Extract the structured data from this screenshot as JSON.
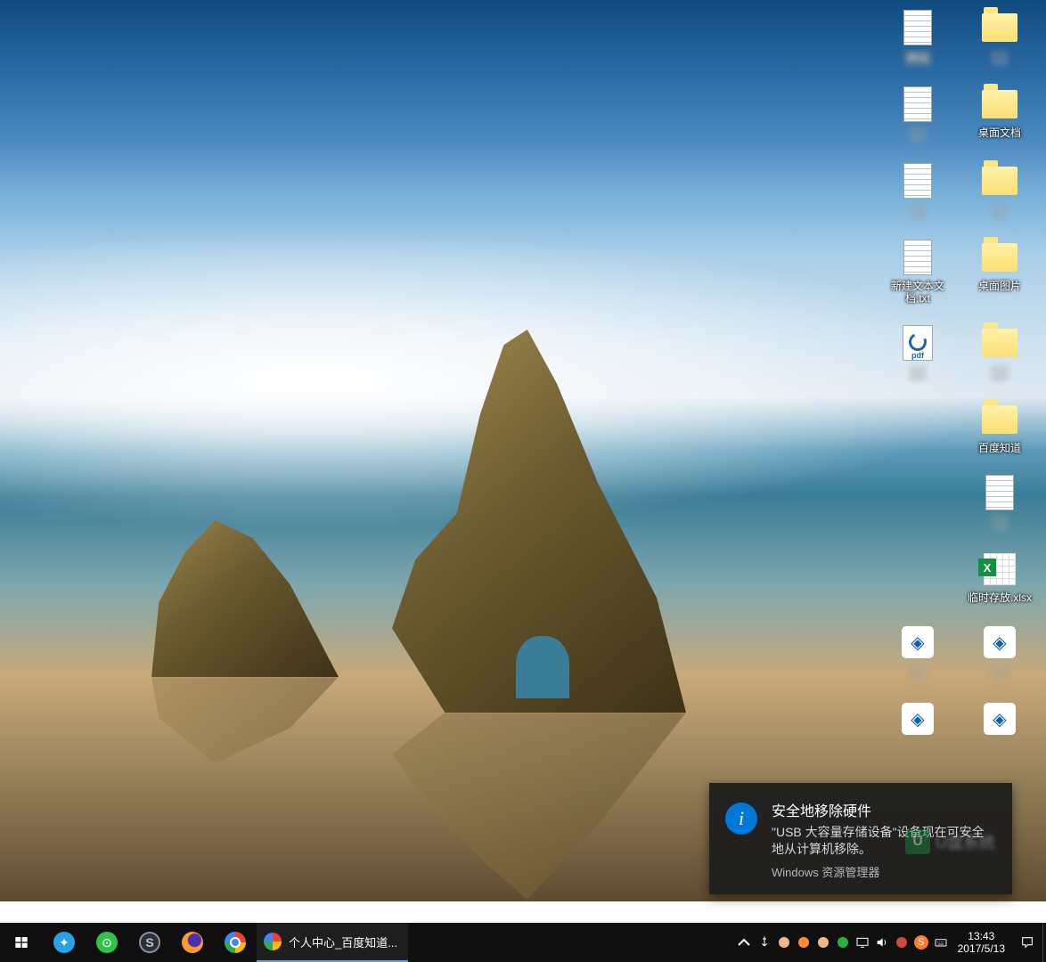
{
  "desktop_icons": [
    {
      "kind": "txt",
      "label": "网站",
      "blur": true
    },
    {
      "kind": "folder",
      "label": "…",
      "blur": true
    },
    {
      "kind": "txt",
      "label": "…",
      "blur": true
    },
    {
      "kind": "folder",
      "label": "桌面文档",
      "blur": false
    },
    {
      "kind": "txt",
      "label": "…",
      "blur": true
    },
    {
      "kind": "folder",
      "label": "…",
      "blur": true
    },
    {
      "kind": "txt",
      "label": "新建文本文档.txt",
      "blur": false
    },
    {
      "kind": "folder",
      "label": "桌面图片",
      "blur": false
    },
    {
      "kind": "pdf",
      "label": "…",
      "blur": true
    },
    {
      "kind": "folder",
      "label": "…",
      "blur": true
    },
    {
      "kind": "none",
      "label": "",
      "blur": false
    },
    {
      "kind": "folder",
      "label": "百度知道",
      "blur": false
    },
    {
      "kind": "none",
      "label": "",
      "blur": false
    },
    {
      "kind": "txt",
      "label": "…",
      "blur": true
    },
    {
      "kind": "none",
      "label": "",
      "blur": false
    },
    {
      "kind": "xlsx",
      "label": "临时存放.xlsx",
      "blur": false
    },
    {
      "kind": "app",
      "label": "…",
      "blur": true
    },
    {
      "kind": "app",
      "label": "…",
      "blur": true
    },
    {
      "kind": "app",
      "label": "",
      "blur": false
    },
    {
      "kind": "app",
      "label": "",
      "blur": false
    }
  ],
  "toast": {
    "title": "安全地移除硬件",
    "message": "\"USB 大容量存储设备\"设备现在可安全地从计算机移除。",
    "source": "Windows 资源管理器"
  },
  "taskbar": {
    "active_task_title": "个人中心_百度知道...",
    "time": "13:43",
    "date": "2017/5/13",
    "pinned": [
      {
        "name": "app-yunfan",
        "bg": "#2aa2e6",
        "glyph": "✦"
      },
      {
        "name": "app-360",
        "bg": "#35c24c",
        "glyph": "⊙"
      },
      {
        "name": "app-sogou",
        "bg": "#000",
        "glyph": "S",
        "ring": true
      },
      {
        "name": "app-firefox",
        "bg1": "#ff9a2e",
        "bg2": "#4d2db0"
      },
      {
        "name": "app-chrome",
        "chrome": true
      }
    ],
    "tray": [
      {
        "name": "tray-usb-icon"
      },
      {
        "name": "tray-bear1-icon",
        "bg": "#f2b889"
      },
      {
        "name": "tray-orange-icon",
        "bg": "#ff8c2e"
      },
      {
        "name": "tray-bear2-icon",
        "bg": "#f2b889"
      },
      {
        "name": "tray-green-icon",
        "bg": "#2db037"
      },
      {
        "name": "tray-monitor-icon"
      },
      {
        "name": "tray-volume-icon"
      },
      {
        "name": "tray-close-icon",
        "bg": "#d24a3a"
      },
      {
        "name": "tray-sogou-icon",
        "bg": "#ff7a2e",
        "glyph": "S"
      },
      {
        "name": "tray-keyboard-icon"
      }
    ]
  },
  "pdf_badge": "pdf"
}
